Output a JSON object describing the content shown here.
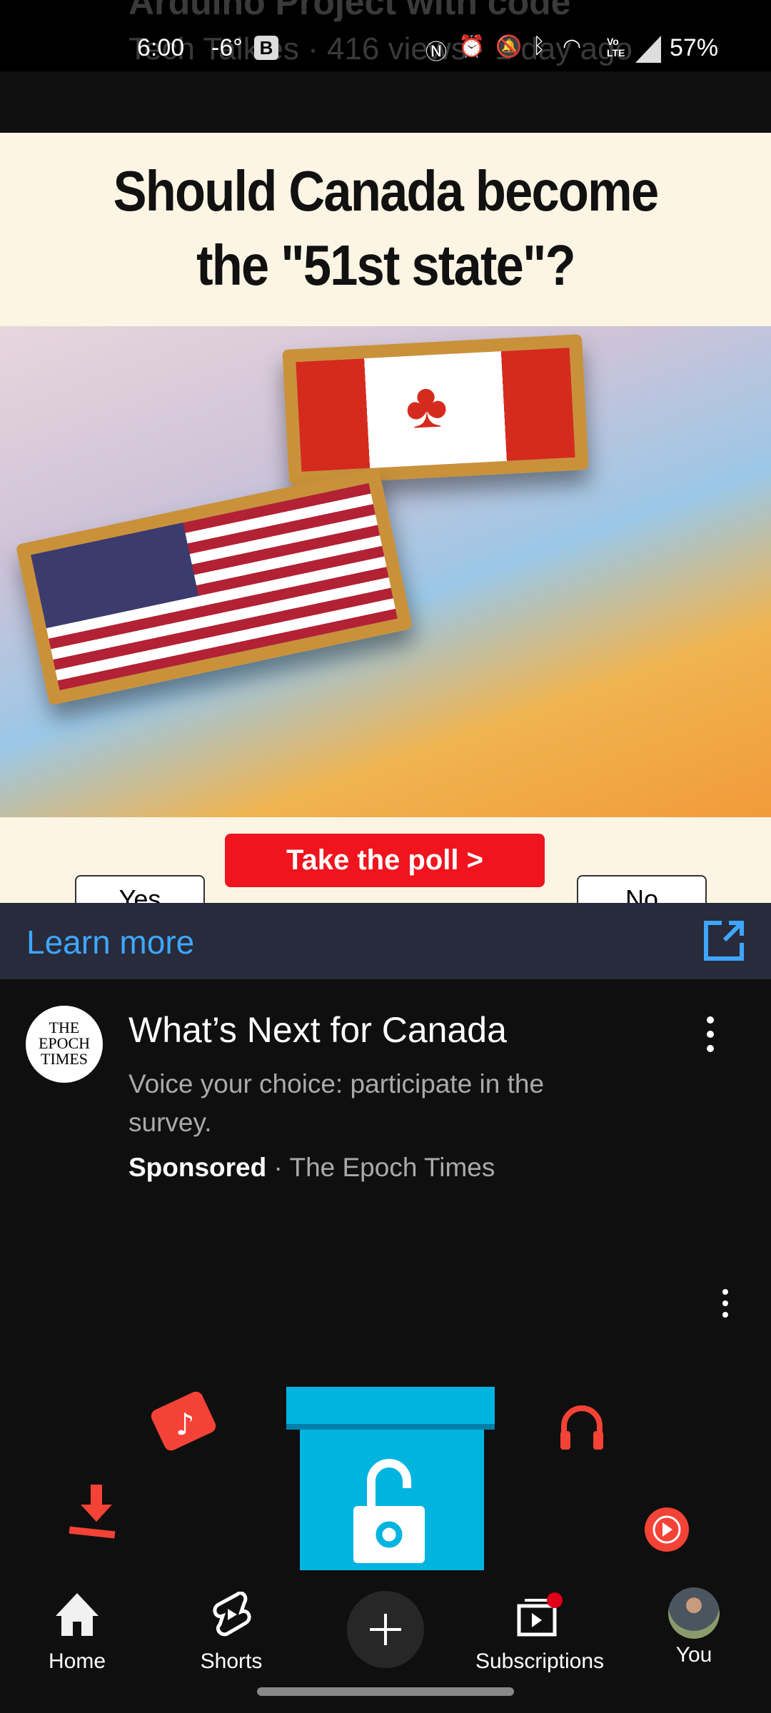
{
  "background_video": {
    "title": "Arduino Project with code",
    "meta": "Tech Talkies · 416 views · 1 day ago"
  },
  "status_bar": {
    "time": "6:00",
    "temperature": "-6°",
    "battery": "57%",
    "icons": [
      "b-icon",
      "nfc-icon",
      "alarm-icon",
      "mute-icon",
      "bluetooth-icon",
      "wifi-icon",
      "volte-icon",
      "signal-icon"
    ]
  },
  "ad": {
    "headline_line1": "Should Canada become",
    "headline_line2": "the \"51st state\"?",
    "yes_label": "Yes",
    "no_label": "No",
    "cta": "Take the poll >",
    "learn_more": "Learn more"
  },
  "ad_info": {
    "logo_text": "THE EPOCH TIMES",
    "title": "What’s Next for Canada",
    "description": "Voice your choice: participate in the survey.",
    "sponsored": "Sponsored",
    "advertiser": "The Epoch Times"
  },
  "nav": {
    "items": [
      {
        "label": "Home"
      },
      {
        "label": "Shorts"
      },
      {
        "label": ""
      },
      {
        "label": "Subscriptions"
      },
      {
        "label": "You"
      }
    ]
  },
  "colors": {
    "accent_blue": "#3ea6ff",
    "cta_red": "#f0141e",
    "promo_blue": "#00b4e0",
    "icon_red": "#f44336"
  }
}
